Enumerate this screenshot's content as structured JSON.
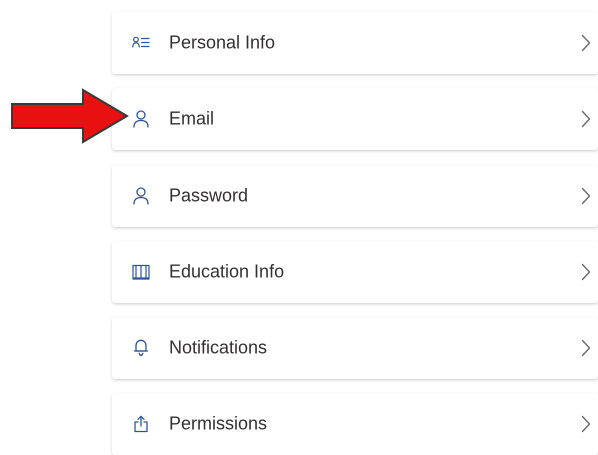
{
  "settings": {
    "items": [
      {
        "id": "personal-info",
        "label": "Personal Info",
        "icon": "person-list-icon"
      },
      {
        "id": "email",
        "label": "Email",
        "icon": "person-icon"
      },
      {
        "id": "password",
        "label": "Password",
        "icon": "person-icon"
      },
      {
        "id": "education-info",
        "label": "Education Info",
        "icon": "book-icon"
      },
      {
        "id": "notifications",
        "label": "Notifications",
        "icon": "bell-icon"
      },
      {
        "id": "permissions",
        "label": "Permissions",
        "icon": "share-upload-icon"
      }
    ]
  },
  "colors": {
    "icon": "#2b579a",
    "chevron": "#6b6b6b",
    "text": "#323130",
    "arrow_fill": "#e81010",
    "arrow_stroke": "#3a3a3a"
  }
}
